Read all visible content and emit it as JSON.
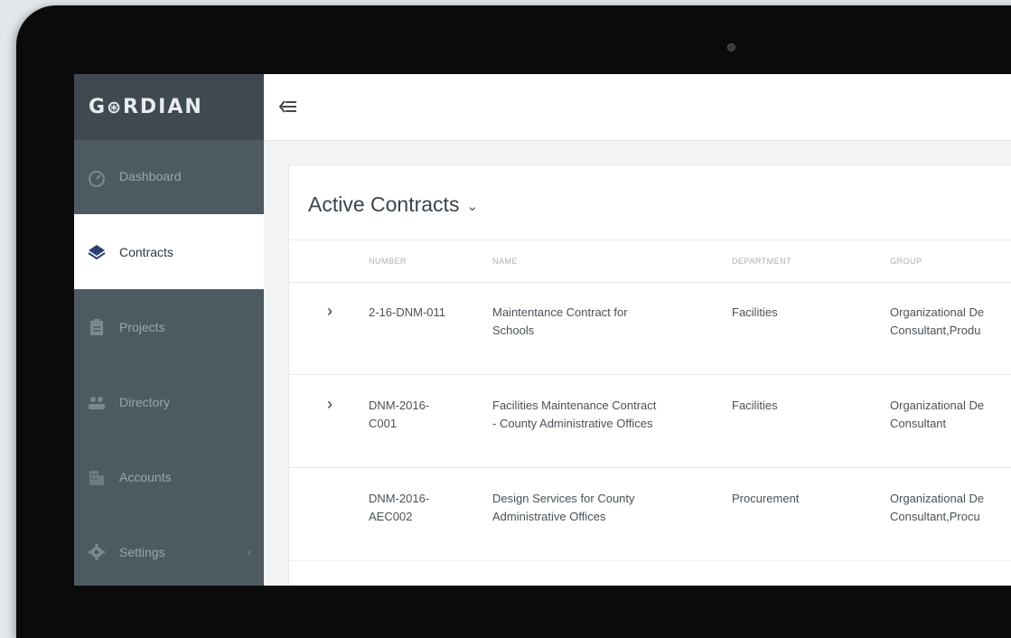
{
  "brand": {
    "logo": "GЁRDIAN"
  },
  "sidebar": {
    "items": [
      {
        "label": "Dashboard",
        "icon": "speedometer-icon"
      },
      {
        "label": "Contracts",
        "icon": "layers-icon"
      },
      {
        "label": "Projects",
        "icon": "clipboard-icon"
      },
      {
        "label": "Directory",
        "icon": "people-icon"
      },
      {
        "label": "Accounts",
        "icon": "building-icon"
      },
      {
        "label": "Settings",
        "icon": "gear-icon",
        "caret": "‹"
      }
    ],
    "active_index": 1
  },
  "topbar": {
    "collapse_icon": "collapse-menu-icon"
  },
  "main": {
    "title": "Active Contracts",
    "title_dropdown": "⌄",
    "columns": [
      "NUMBER",
      "NAME",
      "DEPARTMENT",
      "GROUP"
    ],
    "rows": [
      {
        "expand": "›",
        "number": [
          "2-16-DNM-011"
        ],
        "name": [
          "Maintentance Contract for",
          "Schools"
        ],
        "department": "Facilities",
        "group": [
          "Organizational De",
          "Consultant,Produ"
        ]
      },
      {
        "expand": "›",
        "number": [
          "DNM-2016-",
          "C001"
        ],
        "name": [
          "Facilities Maintenance Contract",
          "- County Administrative Offices"
        ],
        "department": "Facilities",
        "group": [
          "Organizational De",
          "Consultant"
        ]
      },
      {
        "expand": "",
        "number": [
          "DNM-2016-",
          "AEC002"
        ],
        "name": [
          "Design Services for County",
          "Administrative Offices"
        ],
        "department": "Procurement",
        "group": [
          "Organizational De",
          "Consultant,Procu"
        ]
      }
    ]
  },
  "colors": {
    "sidebar": "#4e5a61",
    "sidebar_header": "#3f4a50",
    "accent": "#2b3f73"
  }
}
